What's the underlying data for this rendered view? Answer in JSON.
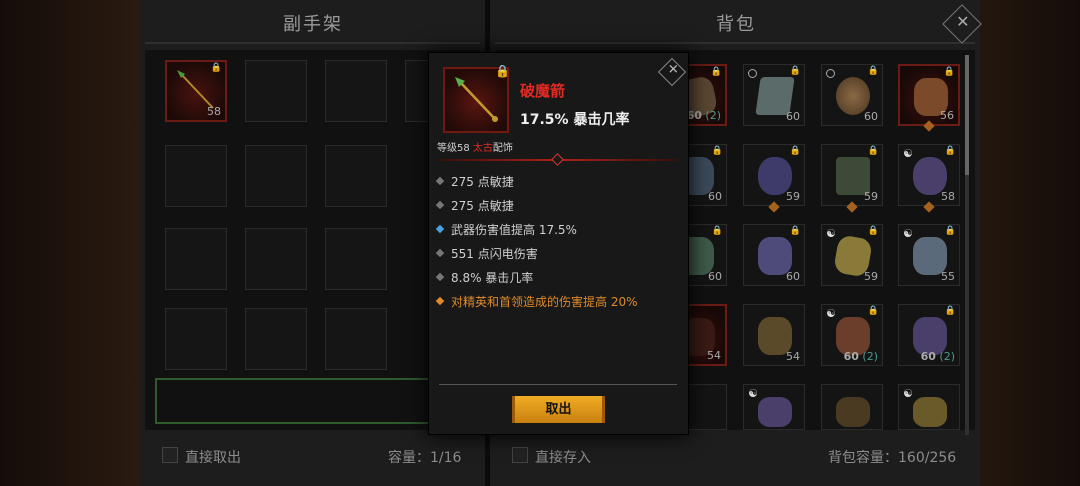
{
  "stash": {
    "title": "副手架",
    "direct_takeout_label": "直接取出",
    "capacity_label": "容量：1/16",
    "item": {
      "level": "58"
    }
  },
  "bag": {
    "title": "背包",
    "direct_store_label": "直接存入",
    "capacity_label": "背包容量：160/256",
    "close_icon": "close-x-icon",
    "levels": {
      "r0c0": "60",
      "r0c0_extra": "(2)",
      "r0c1": "60",
      "r0c2": "60",
      "r0c3": "56",
      "r1c0": "60",
      "r1c1": "59",
      "r1c2": "59",
      "r1c3": "58",
      "r2c0": "60",
      "r2c1": "60",
      "r2c2": "59",
      "r2c3": "55",
      "r3c0": "54",
      "r3c1": "54",
      "r3c2": "60",
      "r3c2_extra": "(2)",
      "r3c3": "60",
      "r3c3_extra": "(2)"
    }
  },
  "tooltip": {
    "item_name": "破魔箭",
    "main_stat": "17.5% 暴击几率",
    "level_prefix": "等级58 ",
    "level_type": "太古",
    "slot_type": "配饰",
    "affixes": [
      "275 点敏捷",
      "275 点敏捷",
      "武器伤害值提高 17.5%",
      "551 点闪电伤害",
      "8.8% 暴击几率",
      "对精英和首领造成的伤害提高 20%"
    ],
    "button_label": "取出"
  },
  "colors": {
    "legendary_red": "#e02a23",
    "orange_affix": "#e08a28",
    "button_gold": "#f0ad22",
    "lock_yellow": "#e5c936"
  }
}
